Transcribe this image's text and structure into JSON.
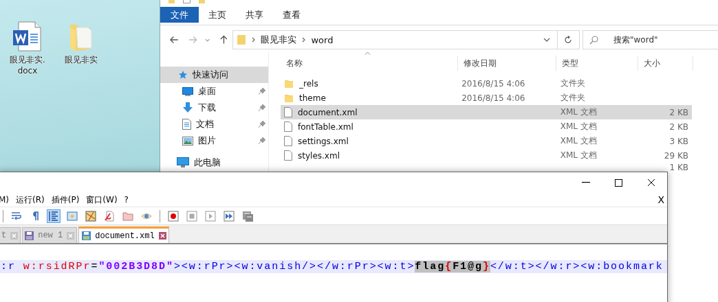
{
  "desktop": {
    "icons": [
      {
        "kind": "word-document",
        "label": "眼见非实.docx"
      },
      {
        "kind": "folder",
        "label": "眼见非实"
      }
    ]
  },
  "explorer": {
    "ribbon_tabs": [
      {
        "label": "文件",
        "selected": true
      },
      {
        "label": "主页",
        "selected": false
      },
      {
        "label": "共享",
        "selected": false
      },
      {
        "label": "查看",
        "selected": false
      }
    ],
    "breadcrumb": [
      "眼见非实",
      "word"
    ],
    "search": {
      "placeholder": "搜索\"word\""
    },
    "nav": [
      {
        "kind": "star",
        "label": "快速访问",
        "selected": true,
        "pinned": false
      },
      {
        "kind": "desktop",
        "label": "桌面",
        "selected": false,
        "pinned": true
      },
      {
        "kind": "download",
        "label": "下载",
        "selected": false,
        "pinned": true
      },
      {
        "kind": "document",
        "label": "文档",
        "selected": false,
        "pinned": true
      },
      {
        "kind": "pictures",
        "label": "图片",
        "selected": false,
        "pinned": true
      },
      {
        "kind": "computer",
        "label": "此电脑",
        "selected": false,
        "pinned": false
      }
    ],
    "columns": [
      "名称",
      "修改日期",
      "类型",
      "大小"
    ],
    "files": [
      {
        "kind": "folder",
        "name": "_rels",
        "modified": "2016/8/15 4:06",
        "type": "文件夹",
        "selected": false
      },
      {
        "kind": "folder",
        "name": "theme",
        "modified": "2016/8/15 4:06",
        "type": "文件夹",
        "selected": false
      },
      {
        "kind": "file",
        "name": "document.xml",
        "type": "XML 文档",
        "size": "2 KB",
        "selected": true
      },
      {
        "kind": "file",
        "name": "fontTable.xml",
        "type": "XML 文档",
        "size": "2 KB",
        "selected": false
      },
      {
        "kind": "file",
        "name": "settings.xml",
        "type": "XML 文档",
        "size": "3 KB",
        "selected": false
      },
      {
        "kind": "file",
        "name": "styles.xml",
        "type": "XML 文档",
        "size": "29 KB",
        "selected": false
      },
      {
        "kind": "file",
        "size": "1 KB",
        "selected": false
      }
    ]
  },
  "editor": {
    "menu": [
      "M)",
      "运行(R)",
      "插件(P)",
      "窗口(W)",
      "?"
    ],
    "close_document": "X",
    "toolbar": [
      {
        "kind": "separator"
      },
      {
        "kind": "wrap",
        "on": false
      },
      {
        "kind": "pilcrow",
        "on": false
      },
      {
        "kind": "indent-guide",
        "on": true
      },
      {
        "kind": "lightning",
        "on": false
      },
      {
        "kind": "map",
        "on": false
      },
      {
        "kind": "pen",
        "on": false
      },
      {
        "kind": "folder",
        "on": false
      },
      {
        "kind": "eye",
        "on": false
      },
      {
        "kind": "separator"
      },
      {
        "kind": "record",
        "on": false
      },
      {
        "kind": "stop",
        "on": false
      },
      {
        "kind": "play",
        "on": false
      },
      {
        "kind": "fast-forward",
        "on": false
      },
      {
        "kind": "save-macro",
        "on": false
      }
    ],
    "tabs": [
      {
        "label": "t",
        "selected": false
      },
      {
        "label": "new 1",
        "selected": false
      },
      {
        "label": "document.xml",
        "selected": true
      }
    ],
    "code": [
      {
        "kind": "tag",
        "text": ":r "
      },
      {
        "kind": "attr",
        "text": "w:rsidRPr"
      },
      {
        "kind": "op",
        "text": "="
      },
      {
        "kind": "value",
        "text": "\"002B3D8D\""
      },
      {
        "kind": "tag",
        "text": "><w:rPr><w:vanish/></w:rPr><w:t>"
      },
      {
        "kind": "match",
        "text": "flag"
      },
      {
        "kind": "match-brace",
        "text": "{"
      },
      {
        "kind": "match",
        "text": "F1@g"
      },
      {
        "kind": "match-brace",
        "text": "}"
      },
      {
        "kind": "tag",
        "text": "</w:t></w:r><w:bookmark"
      }
    ]
  }
}
